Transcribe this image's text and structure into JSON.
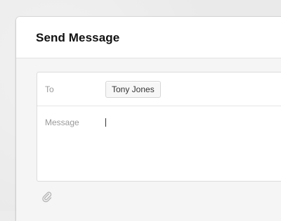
{
  "dialog": {
    "title": "Send Message"
  },
  "form": {
    "to_label": "To",
    "recipient": "Tony Jones",
    "message_label": "Message",
    "message_value": ""
  },
  "icons": {
    "attach": "paperclip-icon"
  },
  "colors": {
    "background": "#eaeaea",
    "panel": "#f5f5f5",
    "header": "#ffffff",
    "label_text": "#9a9a9a",
    "title_text": "#111111"
  }
}
